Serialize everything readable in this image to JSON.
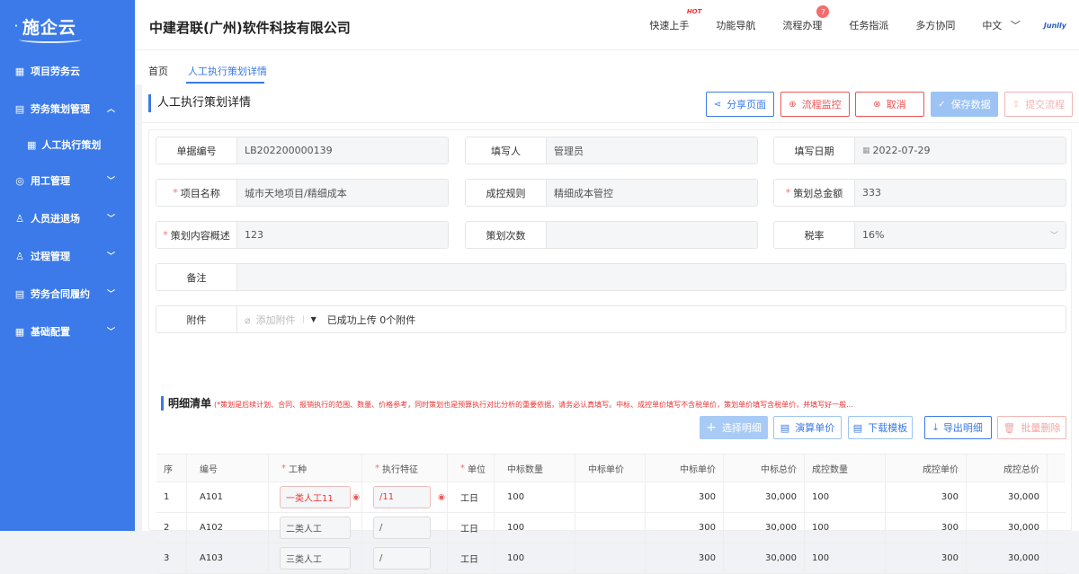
{
  "app": {
    "logo": "施企云"
  },
  "sidebar": {
    "items": [
      {
        "label": "项目劳务云",
        "icon": "grid-icon"
      },
      {
        "label": "劳务策划管理",
        "icon": "document-icon"
      },
      {
        "label": "人工执行策划",
        "icon": "calendar-icon"
      },
      {
        "label": "用工管理",
        "icon": "target-icon"
      },
      {
        "label": "人员进退场",
        "icon": "user-icon"
      },
      {
        "label": "过程管理",
        "icon": "user-gear-icon"
      },
      {
        "label": "劳务合同履约",
        "icon": "contract-icon"
      },
      {
        "label": "基础配置",
        "icon": "grid-icon"
      }
    ]
  },
  "header": {
    "company": "中建君联(广州)软件科技有限公司",
    "nav": [
      "快速上手",
      "功能导航",
      "流程办理",
      "任务指派",
      "多方协同"
    ],
    "hot": "HOT",
    "badge": "7",
    "lang": "中文",
    "brand": "Junlly"
  },
  "tabs": [
    "首页",
    "人工执行策划详情"
  ],
  "page": {
    "title": "人工执行策划详情",
    "buttons": {
      "share": "分享页面",
      "monitor": "流程监控",
      "cancel": "取消",
      "save": "保存数据",
      "submit": "提交流程"
    }
  },
  "form": {
    "doc_no_label": "单据编号",
    "doc_no": "LB202200000139",
    "writer_label": "填写人",
    "writer": "管理员",
    "date_label": "填写日期",
    "date": "2022-07-29",
    "project_label": "项目名称",
    "project": "城市天地项目/精细成本",
    "rule_label": "成控规则",
    "rule": "精细成本管控",
    "total_label": "策划总金额",
    "total": "333",
    "desc_label": "策划内容概述",
    "desc": "123",
    "count_label": "策划次数",
    "count": "",
    "tax_label": "税率",
    "tax": "16%",
    "remark_label": "备注",
    "remark": "",
    "attach_label": "附件",
    "attach_btn": "添加附件",
    "attach_status": "已成功上传 0个附件"
  },
  "detail": {
    "title": "明细清单",
    "note": "(*策划是后续计划、合同、报销执行的范围、数量、价格参考，同时策划也是预算执行对比分析的重要依据，请务必认真填写。中标、成控单价填写不含税单价，策划单价填写含税单价，并填写好一般...",
    "buttons": {
      "select": "选择明细",
      "calc": "演算单价",
      "download": "下载模板",
      "export": "导出明细",
      "delete": "批量删除"
    },
    "columns": [
      "序",
      "编号",
      "工种",
      "执行特征",
      "单位",
      "中标数量",
      "中标单价",
      "中标单价",
      "中标总价",
      "成控数量",
      "成控单价",
      "成控总价"
    ],
    "rows": [
      {
        "no": "1",
        "code": "A101",
        "type": "一类人工11",
        "feature": "/11",
        "unit": "工日",
        "bid_qty": "100",
        "bid_unit": "",
        "bid_price": "300",
        "bid_total": "30,000",
        "ctrl_qty": "100",
        "ctrl_price": "300",
        "ctrl_total": "30,000"
      },
      {
        "no": "2",
        "code": "A102",
        "type": "二类人工",
        "feature": "/",
        "unit": "工日",
        "bid_qty": "100",
        "bid_unit": "",
        "bid_price": "300",
        "bid_total": "30,000",
        "ctrl_qty": "100",
        "ctrl_price": "300",
        "ctrl_total": "30,000"
      },
      {
        "no": "3",
        "code": "A103",
        "type": "三类人工",
        "feature": "/",
        "unit": "工日",
        "bid_qty": "100",
        "bid_unit": "",
        "bid_price": "300",
        "bid_total": "30,000",
        "ctrl_qty": "100",
        "ctrl_price": "300",
        "ctrl_total": "30,000"
      }
    ]
  },
  "colors": {
    "primary": "#3b7ae8",
    "danger": "#e55555"
  }
}
